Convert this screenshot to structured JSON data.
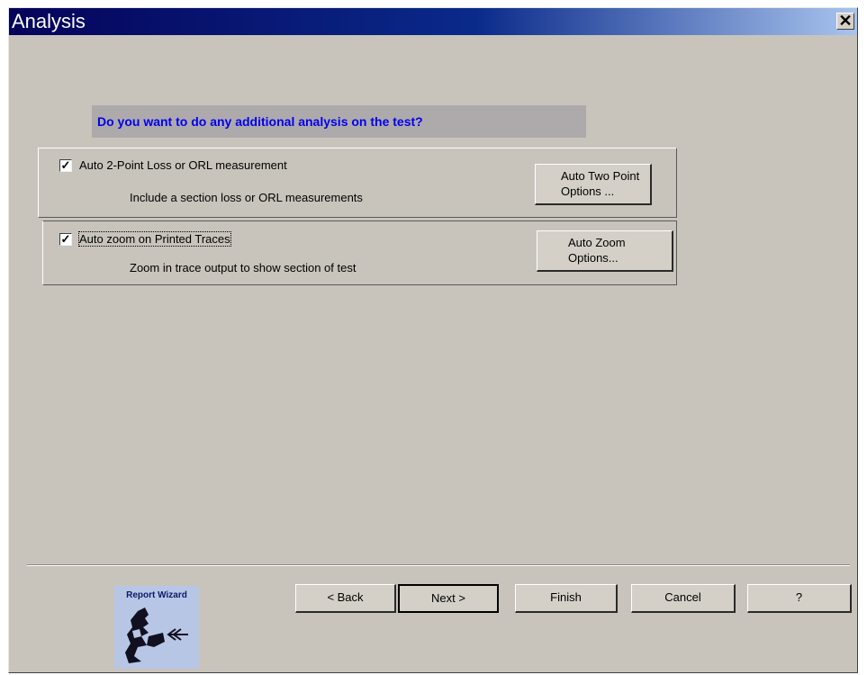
{
  "window": {
    "title": "Analysis",
    "close_label": "✕"
  },
  "question": "Do you want to do any additional analysis on the test?",
  "options": [
    {
      "checked": true,
      "label": "Auto 2-Point Loss or ORL measurement",
      "description": "Include a section loss or ORL measurements",
      "button_line1": "Auto Two Point",
      "button_line2": "Options ..."
    },
    {
      "checked": true,
      "label": "Auto zoom on Printed Traces",
      "description": "Zoom in trace output to show section of test",
      "button_line1": "Auto Zoom",
      "button_line2": "Options..."
    }
  ],
  "nav": {
    "back": "< Back",
    "next": "Next >",
    "finish": "Finish",
    "cancel": "Cancel",
    "help": "?"
  },
  "logo": {
    "caption": "Report Wizard",
    "icon": "wizard-figure-icon"
  },
  "colors": {
    "title_start": "#05035a",
    "title_end": "#a8c4ee",
    "question": "#0000ee",
    "face": "#c8c4bc"
  }
}
